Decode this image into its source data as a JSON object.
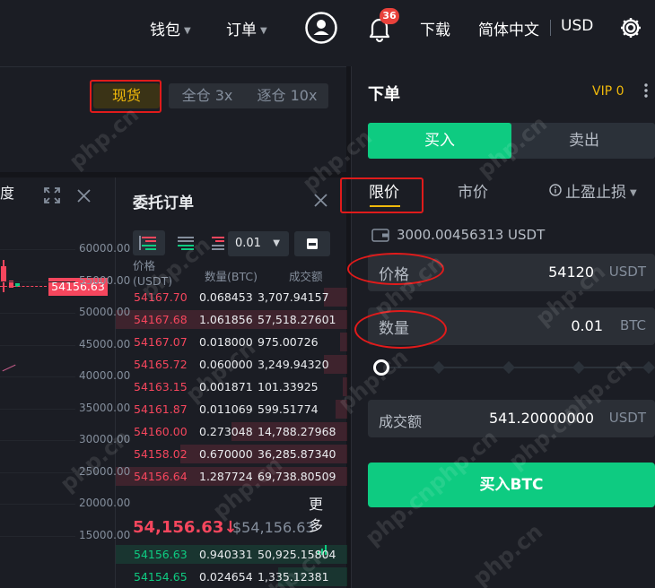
{
  "header": {
    "wallet_label": "钱包",
    "orders_label": "订单",
    "notification_count": "36",
    "download_label": "下载",
    "language_label": "简体中文",
    "currency_label": "USD"
  },
  "trade_mode": {
    "spot_label": "现货",
    "cross_label": "全仓 3x",
    "isolated_label": "逐仓 10x"
  },
  "chart": {
    "partial_title": "度",
    "y_ticks": [
      "60000.00",
      "55000.00",
      "50000.00",
      "45000.00",
      "40000.00",
      "35000.00",
      "30000.00",
      "25000.00",
      "20000.00",
      "15000.00"
    ],
    "current_price_tag": "54156.63"
  },
  "order_book": {
    "title": "委托订单",
    "precision": "0.01",
    "col_price": "价格\n(USDT)",
    "col_qty": "数量(BTC)",
    "col_total": "成交额",
    "asks": [
      {
        "price": "54167.70",
        "qty": "0.068453",
        "total": "3,707.94157",
        "depth": 0.1
      },
      {
        "price": "54167.68",
        "qty": "1.061856",
        "total": "57,518.27601",
        "depth": 1.0
      },
      {
        "price": "54167.07",
        "qty": "0.018000",
        "total": "975.00726",
        "depth": 0.03
      },
      {
        "price": "54165.72",
        "qty": "0.060000",
        "total": "3,249.94320",
        "depth": 0.1
      },
      {
        "price": "54163.15",
        "qty": "0.001871",
        "total": "101.33925",
        "depth": 0.02
      },
      {
        "price": "54161.87",
        "qty": "0.011069",
        "total": "599.51774",
        "depth": 0.05
      },
      {
        "price": "54160.00",
        "qty": "0.273048",
        "total": "14,788.27968",
        "depth": 0.5
      },
      {
        "price": "54158.02",
        "qty": "0.670000",
        "total": "36,285.87340",
        "depth": 0.72
      },
      {
        "price": "54156.64",
        "qty": "1.287724",
        "total": "69,738.80509",
        "depth": 1.0
      }
    ],
    "last_price": "54,156.63",
    "last_price_arrow": "↓",
    "last_price_usd": "$54,156.63",
    "more_label": "更多",
    "bids": [
      {
        "price": "54156.63",
        "qty": "0.940331",
        "total": "50,925.15804",
        "depth": 1.0
      },
      {
        "price": "54154.65",
        "qty": "0.024654",
        "total": "1,335.12381",
        "depth": 0.3
      }
    ]
  },
  "order_form": {
    "title": "下单",
    "vip_label": "VIP 0",
    "buy_tab": "买入",
    "sell_tab": "卖出",
    "type_limit": "限价",
    "type_market": "市价",
    "type_stop": "止盈止损",
    "available_balance": "3000.00456313 USDT",
    "price_label": "价格",
    "price_value": "54120",
    "price_unit": "USDT",
    "amount_label": "数量",
    "amount_value": "0.01",
    "amount_unit": "BTC",
    "total_label": "成交额",
    "total_value": "541.20000000",
    "total_unit": "USDT",
    "submit_label": "买入BTC",
    "slider_percent": 0
  },
  "colors": {
    "buy_green": "#0ecb81",
    "sell_red": "#f6465d",
    "vip_gold": "#f0b90b"
  },
  "watermark": "php.cn"
}
